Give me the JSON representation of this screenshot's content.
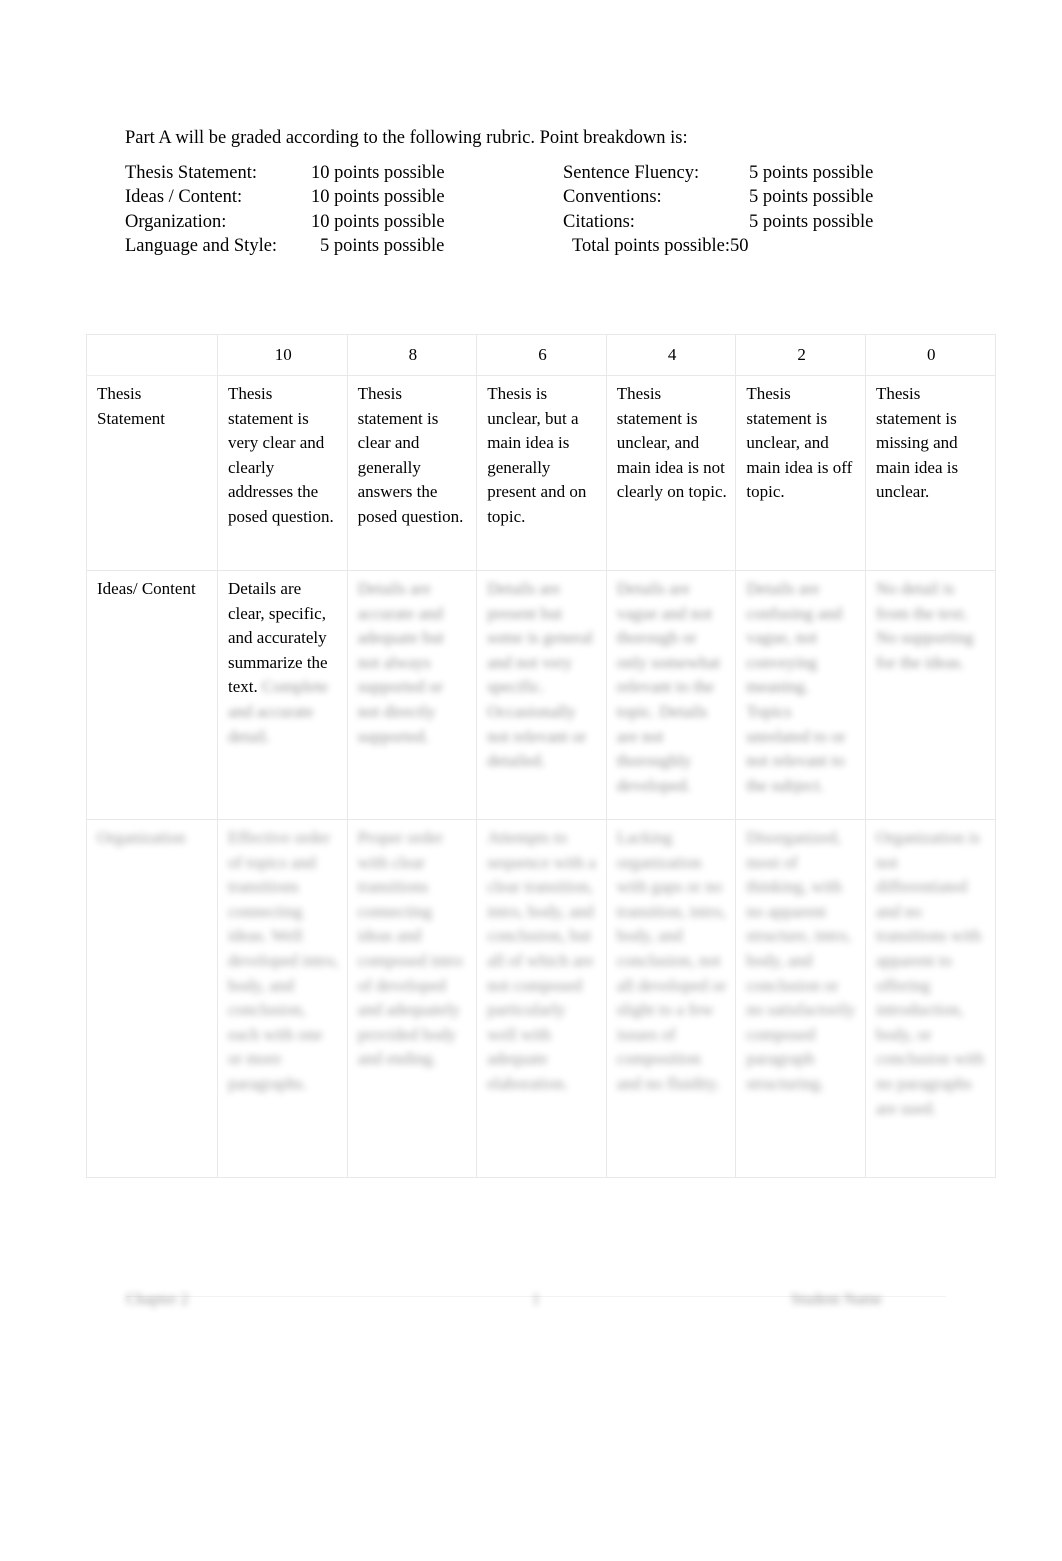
{
  "document": {
    "intro_line": "Part A will be graded according to the following rubric. Point breakdown is:",
    "breakdown": {
      "left": [
        {
          "label": "Thesis Statement:",
          "value": "10 points possible"
        },
        {
          "label": "Ideas / Content:",
          "value": "10 points possible"
        },
        {
          "label": "Organization:",
          "value": "10 points possible"
        },
        {
          "label": "Language and Style:",
          "value": "5 points possible"
        }
      ],
      "right": [
        {
          "label": "Sentence Fluency:",
          "value": "5 points possible"
        },
        {
          "label": "Conventions:",
          "value": "5 points possible"
        },
        {
          "label": "Citations:",
          "value": "5 points possible"
        }
      ],
      "total": "Total points possible:50"
    }
  },
  "rubric": {
    "headers": {
      "criterion": "",
      "scores": [
        "10",
        "8",
        "6",
        "4",
        "2",
        "0"
      ]
    },
    "rows": [
      {
        "criterion": "Thesis Statement",
        "criterion_legible": true,
        "cells": [
          {
            "text": "Thesis statement is very clear and clearly addresses the posed question.",
            "legible": true
          },
          {
            "text": "Thesis statement is clear and generally answers the posed question.",
            "legible": true
          },
          {
            "text": "Thesis is unclear, but a main idea is generally present and on topic.",
            "legible": true
          },
          {
            "text": "Thesis statement is unclear, and main idea is not clearly on topic.",
            "legible": true
          },
          {
            "text": "Thesis statement is unclear, and main idea is off topic.",
            "legible": true
          },
          {
            "text": "Thesis statement is missing and main idea is unclear.",
            "legible": true
          }
        ]
      },
      {
        "criterion": "Ideas/ Content",
        "criterion_legible": true,
        "cells": [
          {
            "text": "Details are clear, specific, and accurately summarize the text.",
            "legible": true,
            "trailing_blurred": "Complete and accurate detail."
          },
          {
            "text": "Details are accurate and adequate but not always supported or not directly supported.",
            "legible": false
          },
          {
            "text": "Details are present but some is general and not very specific. Occasionally not relevant or detailed.",
            "legible": false
          },
          {
            "text": "Details are vague and not thorough or only somewhat relevant to the topic. Details are not thoroughly developed.",
            "legible": false
          },
          {
            "text": "Details are confusing and vague, not conveying meaning. Topics unrelated to or not relevant to the subject.",
            "legible": false
          },
          {
            "text": "No detail is from the text. No supporting for the ideas.",
            "legible": false
          }
        ]
      },
      {
        "criterion": "Organization",
        "criterion_legible": false,
        "cells": [
          {
            "text": "Effective order of topics and transitions connecting ideas. Well developed intro, body, and conclusion, each with one or more paragraphs.",
            "legible": false
          },
          {
            "text": "Proper order with clear transitions connecting ideas and composed intro of developed and adequately provided body and ending.",
            "legible": false
          },
          {
            "text": "Attempts to sequence with a clear transition, intro, body, and conclusion, but all of which are not composed particularly well with adequate elaboration.",
            "legible": false
          },
          {
            "text": "Lacking organization with gaps or no transition, intro, body, and conclusion, not all developed or slight to a few issues of composition and no fluidity.",
            "legible": false
          },
          {
            "text": "Disorganized, most of thinking, with no apparent structure, intro, body, and conclusion or no satisfactorily composed paragraph structuring.",
            "legible": false
          },
          {
            "text": "Organization is not differentiated and no transitions with apparent to offering introduction, body, or conclusion with no paragraphs are used.",
            "legible": false
          }
        ]
      }
    ]
  },
  "footer": {
    "left": "Chapter 2",
    "center": "1",
    "right": "Student Name"
  }
}
